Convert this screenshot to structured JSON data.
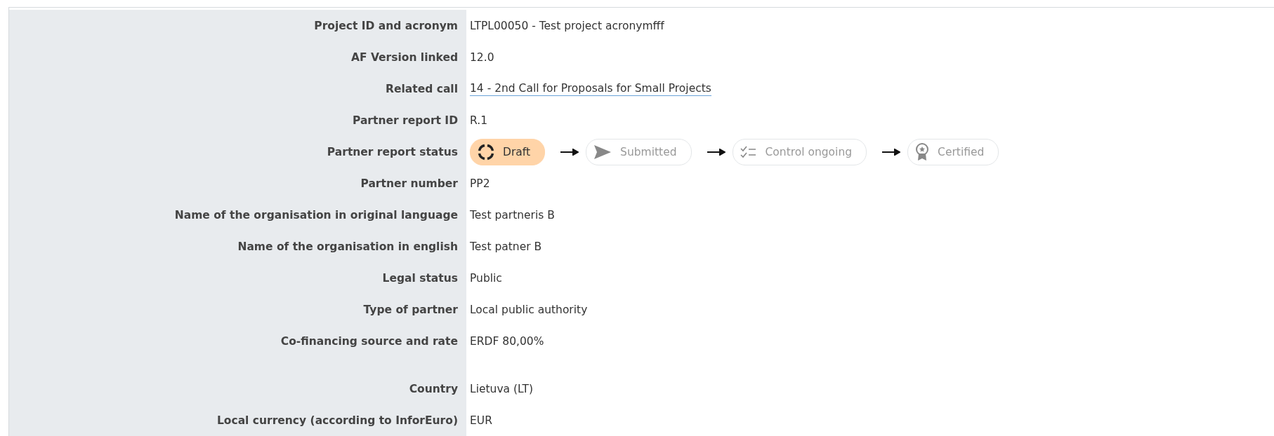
{
  "rows": [
    {
      "label": "Project ID and acronym",
      "kind": "text",
      "value": "LTPL00050 - Test project acronymfff"
    },
    {
      "label": "AF Version linked",
      "kind": "text",
      "value": "12.0"
    },
    {
      "label": "Related call",
      "kind": "link",
      "value": "14 - 2nd Call for Proposals for Small Projects"
    },
    {
      "label": "Partner report ID",
      "kind": "text",
      "value": "R.1"
    },
    {
      "label": "Partner report status",
      "kind": "status",
      "steps": [
        {
          "label": "Draft",
          "kind": "draft",
          "selected": true
        },
        {
          "label": "Submitted",
          "kind": "submitted",
          "selected": false
        },
        {
          "label": "Control ongoing",
          "kind": "control",
          "selected": false
        },
        {
          "label": "Certified",
          "kind": "certified",
          "selected": false
        }
      ]
    },
    {
      "label": "Partner number",
      "kind": "text",
      "value": "PP2"
    },
    {
      "label": "Name of the organisation in original language",
      "kind": "text",
      "value": "Test partneris B"
    },
    {
      "label": "Name of the organisation in english",
      "kind": "text",
      "value": "Test patner B"
    },
    {
      "label": "Legal status",
      "kind": "text",
      "value": "Public"
    },
    {
      "label": "Type of partner",
      "kind": "text",
      "value": "Local public authority"
    },
    {
      "label": "Co-financing source and rate",
      "kind": "text",
      "value": "ERDF 80,00%"
    },
    {
      "label": "Country",
      "kind": "text",
      "value": "Lietuva (LT)",
      "gap_before": true
    },
    {
      "label": "Local currency (according to InforEuro)",
      "kind": "text",
      "value": "EUR"
    }
  ]
}
